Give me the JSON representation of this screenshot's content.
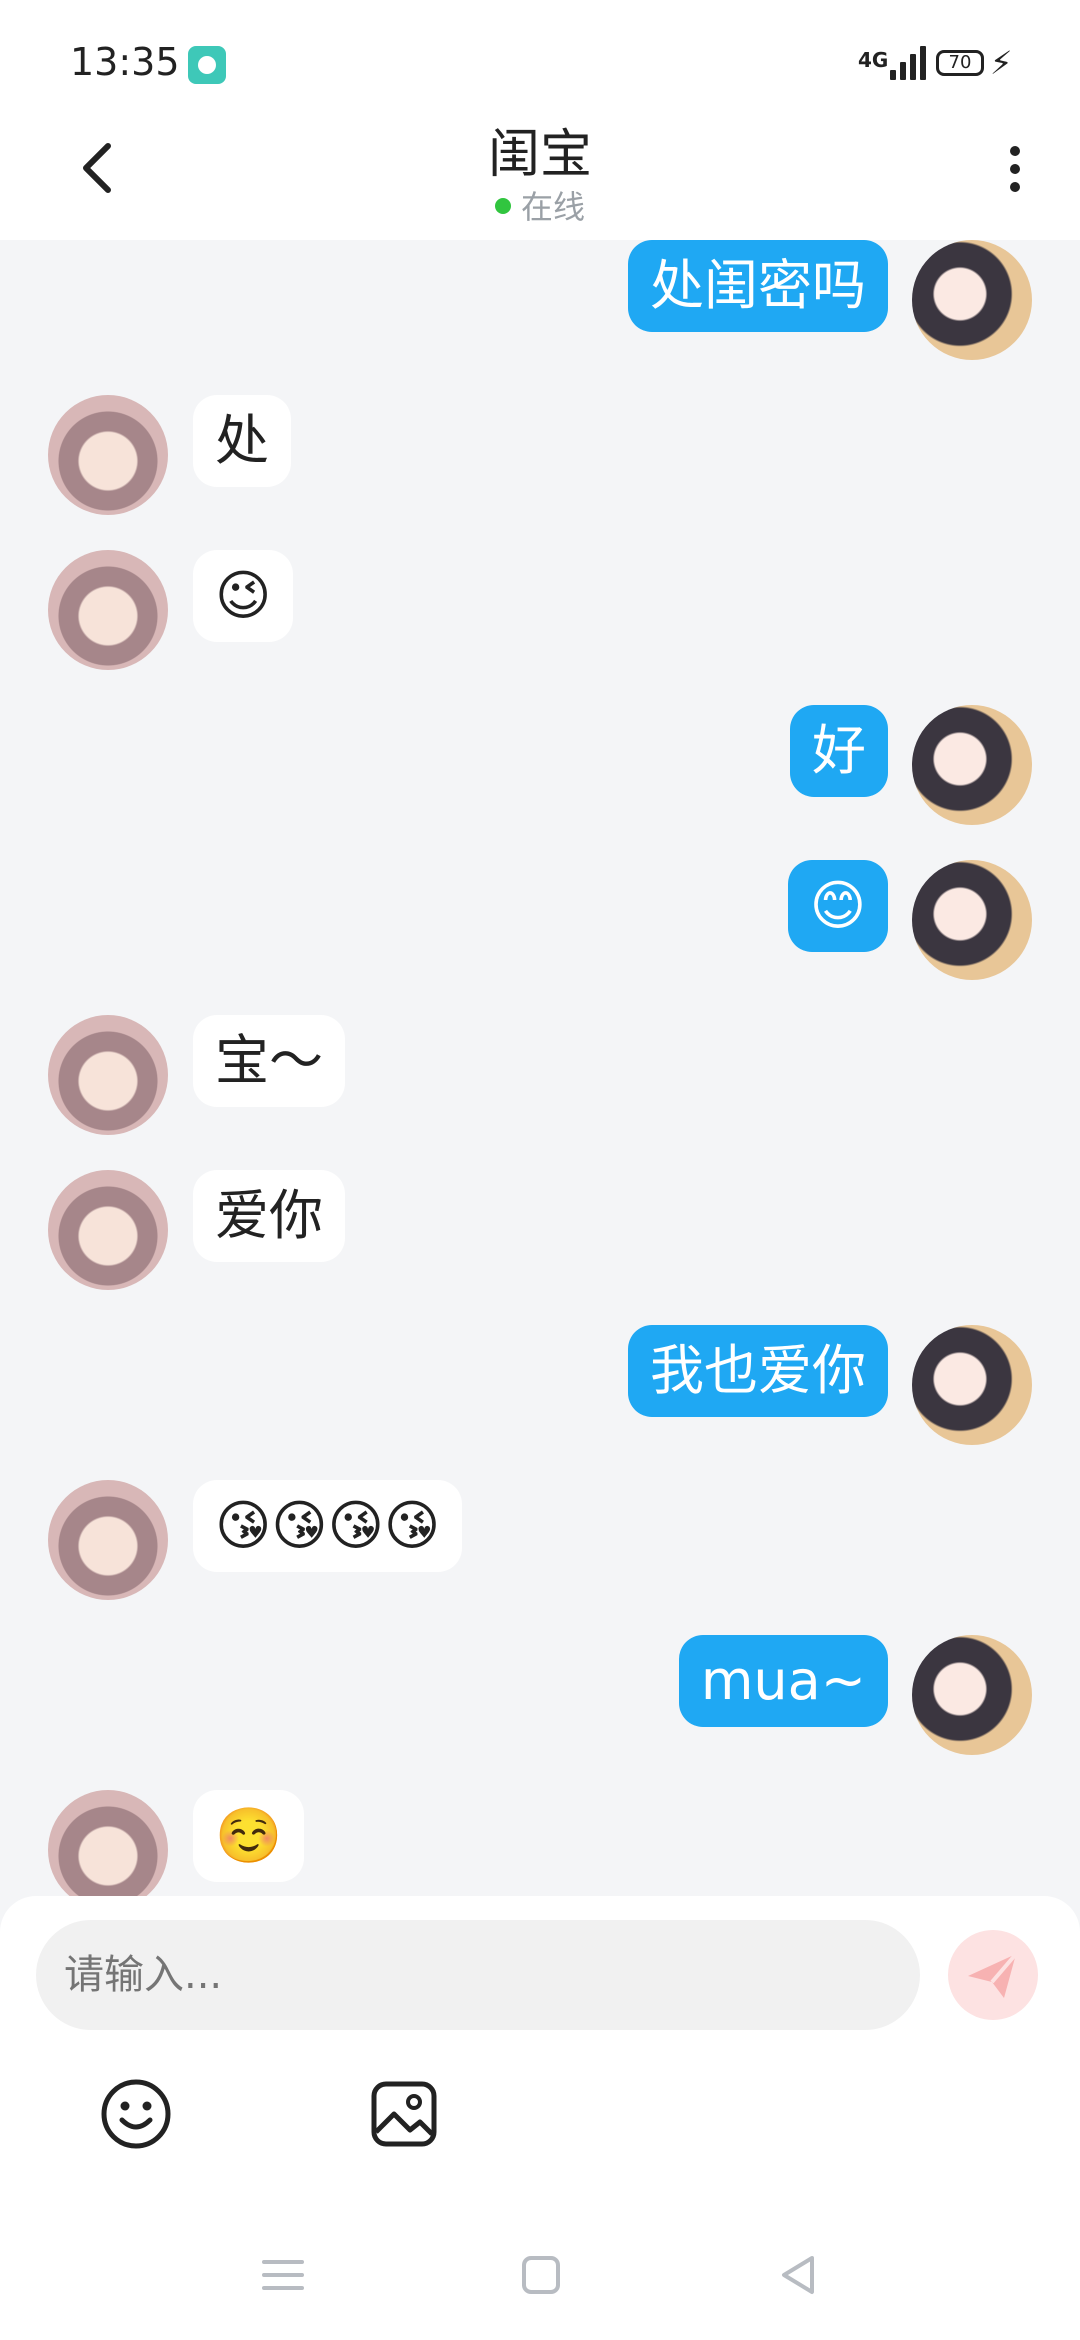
{
  "status_bar": {
    "time": "13:35",
    "network": "4G",
    "battery": "70"
  },
  "header": {
    "title": "闺宝",
    "status": "在线"
  },
  "messages": [
    {
      "side": "out",
      "text": "处闺密吗"
    },
    {
      "side": "in",
      "text": "处"
    },
    {
      "side": "in",
      "text": "😉"
    },
    {
      "side": "out",
      "text": "好"
    },
    {
      "side": "out",
      "text": "😊"
    },
    {
      "side": "in",
      "text": "宝～"
    },
    {
      "side": "in",
      "text": "爱你"
    },
    {
      "side": "out",
      "text": "我也爱你"
    },
    {
      "side": "in",
      "text": "😘😘😘😘"
    },
    {
      "side": "out",
      "text": "mua~"
    },
    {
      "side": "in",
      "text": "☺️"
    }
  ],
  "composer": {
    "placeholder": "请输入..."
  },
  "icons": {
    "back": "chevron-left-icon",
    "more": "more-vertical-icon",
    "send": "send-icon",
    "emoji": "emoji-icon",
    "image": "image-icon",
    "nav_menu": "menu-icon",
    "nav_home": "home-square-icon",
    "nav_back": "back-triangle-icon"
  },
  "colors": {
    "outgoing_bubble": "#1fa8f3",
    "incoming_bubble": "#ffffff",
    "online_dot": "#31c53f"
  }
}
